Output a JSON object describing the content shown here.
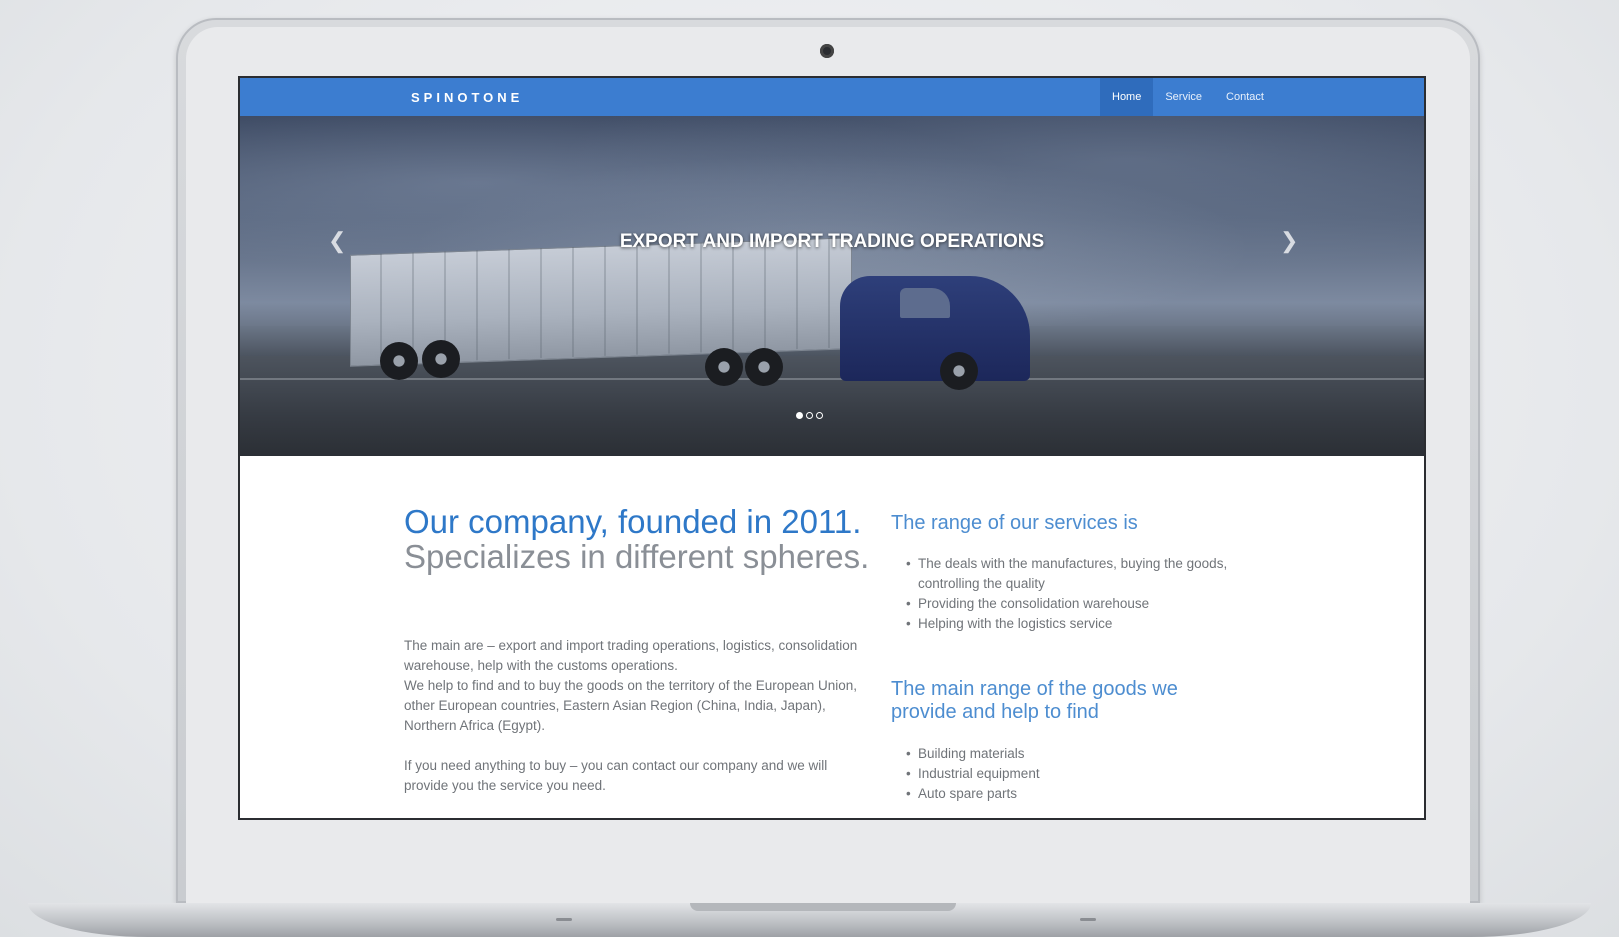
{
  "site": {
    "brand": "SPINOTONE",
    "nav": [
      {
        "label": "Home",
        "active": true
      },
      {
        "label": "Service",
        "active": false
      },
      {
        "label": "Contact",
        "active": false
      }
    ],
    "hero": {
      "title": "EXPORT AND IMPORT TRADING OPERATIONS",
      "prev_icon": "chevron-left-icon",
      "next_icon": "chevron-right-icon",
      "slides_count": 3,
      "active_slide": 1
    },
    "headline": {
      "accent": "Our company, founded in 2011.",
      "rest": " Specializes in different spheres."
    },
    "paragraphs": {
      "p1": "The main are – export and import trading operations, logistics, consolidation warehouse, help with the customs operations.",
      "p2": "We help to find and to buy the goods on the territory of the European Union, other European countries, Eastern Asian Region (China, India, Japan), Northern Africa (Egypt).",
      "p3": "If you need anything to buy – you can contact our company and we will provide you the service you need."
    },
    "services": {
      "title": "The range of our services is",
      "items": [
        "The deals with the manufactures, buying the goods, controlling the quality",
        "Providing the consolidation warehouse",
        "Helping with the logistics service"
      ]
    },
    "goods": {
      "title": "The main range of the goods we provide and help to find",
      "items": [
        "Building materials",
        "Industrial equipment",
        "Auto spare parts"
      ]
    },
    "colors": {
      "nav_bg": "#3c7dd0",
      "accent": "#2e78c8",
      "heading_blue": "#4d8dd0",
      "body_text": "#707479"
    }
  }
}
